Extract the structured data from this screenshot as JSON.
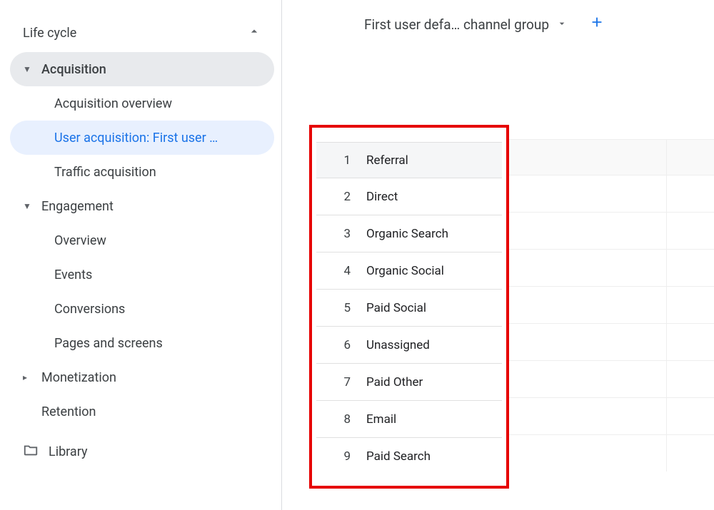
{
  "sidebar": {
    "section_label": "Life cycle",
    "groups": [
      {
        "label": "Acquisition",
        "expanded": true,
        "items": [
          {
            "label": "Acquisition overview"
          },
          {
            "label": "User acquisition: First user …",
            "selected": true
          },
          {
            "label": "Traffic acquisition"
          }
        ]
      },
      {
        "label": "Engagement",
        "expanded": true,
        "items": [
          {
            "label": "Overview"
          },
          {
            "label": "Events"
          },
          {
            "label": "Conversions"
          },
          {
            "label": "Pages and screens"
          }
        ]
      },
      {
        "label": "Monetization",
        "expanded": false
      },
      {
        "label": "Retention",
        "leaf": true
      }
    ],
    "library_label": "Library"
  },
  "main": {
    "dimension_picker_label": "First user defa… channel group",
    "channel_rows": [
      {
        "n": "1",
        "name": "Referral"
      },
      {
        "n": "2",
        "name": "Direct"
      },
      {
        "n": "3",
        "name": "Organic Search"
      },
      {
        "n": "4",
        "name": "Organic Social"
      },
      {
        "n": "5",
        "name": "Paid Social"
      },
      {
        "n": "6",
        "name": "Unassigned"
      },
      {
        "n": "7",
        "name": "Paid Other"
      },
      {
        "n": "8",
        "name": "Email"
      },
      {
        "n": "9",
        "name": "Paid Search"
      }
    ]
  }
}
